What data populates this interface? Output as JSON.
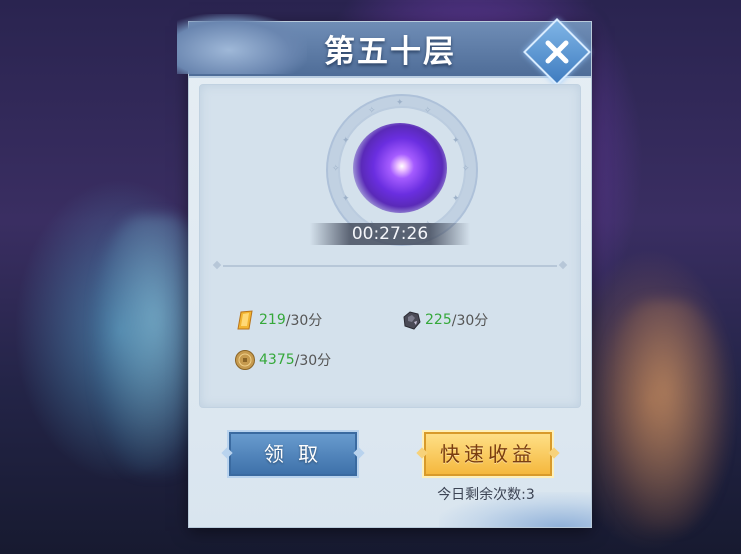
{
  "panel": {
    "title": "第五十层",
    "close_icon": "close-icon"
  },
  "timer": "00:27:26",
  "rewards": [
    {
      "icon": "gold-crystal-icon",
      "value": "219",
      "rate": "/30分",
      "color": "#35a83a"
    },
    {
      "icon": "ore-stone-icon",
      "value": "225",
      "rate": "/30分",
      "color": "#35a83a"
    },
    {
      "icon": "copper-coin-icon",
      "value": "4375",
      "rate": "/30分",
      "color": "#35a83a"
    }
  ],
  "buttons": {
    "claim": "领 取",
    "quick": "快速收益"
  },
  "remaining": "今日剩余次数:3"
}
